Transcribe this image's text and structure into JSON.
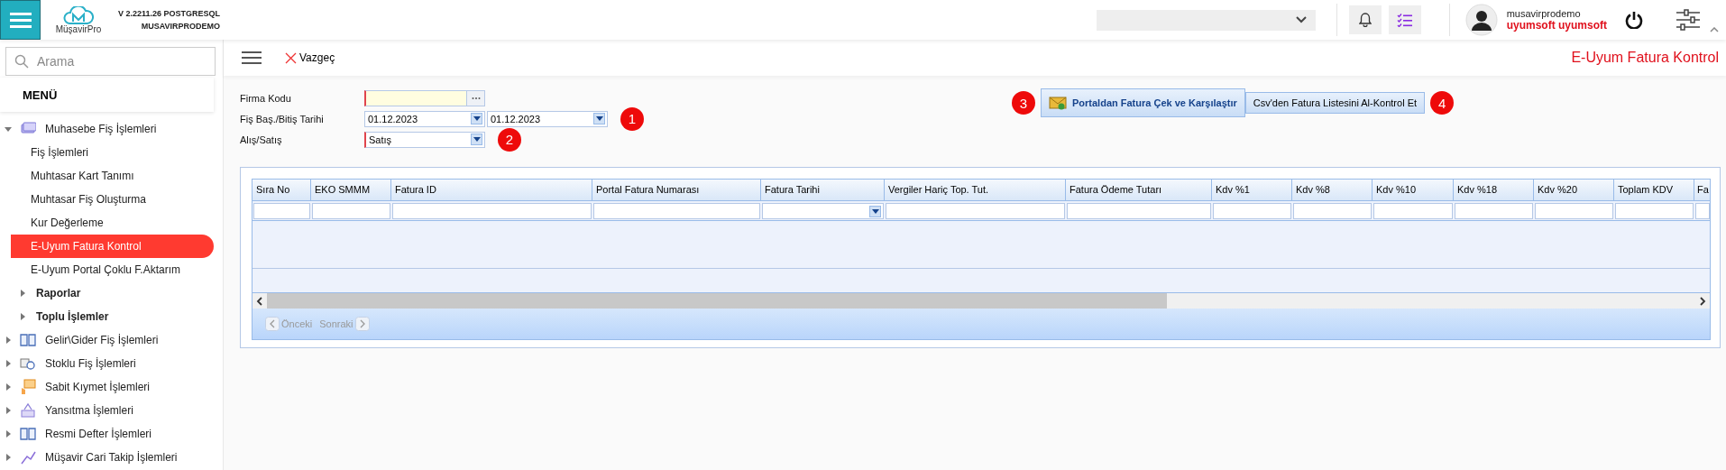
{
  "header": {
    "logo_text": "MüşavirPro",
    "version": "V 2.2211.26 POSTGRESQL",
    "database": "MUSAVIRPRODEMO",
    "user_name": "musavirprodemo",
    "user_company": "uyumsoft uyumsoft"
  },
  "sidebar": {
    "search_placeholder": "Arama",
    "menu_title": "MENÜ",
    "items": [
      {
        "label": "Muhasebe Fiş İşlemleri",
        "kind": "group",
        "expanded": true,
        "selected": false,
        "children": [
          {
            "label": "Fiş İşlemleri",
            "kind": "link",
            "selected": false
          },
          {
            "label": "Muhtasar Kart Tanımı",
            "kind": "link",
            "selected": false
          },
          {
            "label": "Muhtasar Fiş Oluşturma",
            "kind": "link",
            "selected": false
          },
          {
            "label": "Kur Değerleme",
            "kind": "link",
            "selected": false
          },
          {
            "label": "E-Uyum Fatura Kontrol",
            "kind": "link",
            "selected": true
          },
          {
            "label": "E-Uyum Portal Çoklu F.Aktarım",
            "kind": "link",
            "selected": false
          },
          {
            "label": "Raporlar",
            "kind": "group",
            "expanded": false,
            "selected": false
          },
          {
            "label": "Toplu İşlemler",
            "kind": "group",
            "expanded": false,
            "selected": false
          }
        ]
      },
      {
        "label": "Gelir\\Gider Fiş İşlemleri",
        "kind": "group",
        "expanded": false,
        "selected": false
      },
      {
        "label": "Stoklu Fiş İşlemleri",
        "kind": "group",
        "expanded": false,
        "selected": false
      },
      {
        "label": "Sabit Kıymet İşlemleri",
        "kind": "group",
        "expanded": false,
        "selected": false
      },
      {
        "label": "Yansıtma İşlemleri",
        "kind": "group",
        "expanded": false,
        "selected": false
      },
      {
        "label": "Resmi Defter İşlemleri",
        "kind": "group",
        "expanded": false,
        "selected": false
      },
      {
        "label": "Müşavir Cari Takip İşlemleri",
        "kind": "group",
        "expanded": false,
        "selected": false
      }
    ]
  },
  "toolbar": {
    "cancel_label": "Vazgeç",
    "page_title": "E-Uyum Fatura Kontrol"
  },
  "form": {
    "rows": [
      {
        "label": "Firma Kodu",
        "fields": [
          {
            "kind": "lookup",
            "required": true
          }
        ]
      },
      {
        "label": "Fiş Baş./Bitiş Tarihi",
        "fields": [
          {
            "kind": "combo",
            "value": "01.12.2023",
            "required": false
          },
          {
            "kind": "combo",
            "value": "01.12.2023",
            "required": false
          }
        ],
        "badge": "1"
      },
      {
        "label": "Alış/Satış",
        "fields": [
          {
            "kind": "combo",
            "value": "Satış",
            "required": true
          }
        ],
        "badge": "2"
      }
    ]
  },
  "actions": [
    {
      "kind": "badge",
      "text": "3"
    },
    {
      "kind": "button",
      "label": "Portaldan Fatura Çek ve Karşılaştır",
      "primary": true
    },
    {
      "kind": "button",
      "label": "Csv'den Fatura Listesini Al-Kontrol Et",
      "primary": false
    },
    {
      "kind": "badge",
      "text": "4"
    }
  ],
  "grid": {
    "columns": [
      {
        "label": "Sıra No",
        "filter_dropdown": false
      },
      {
        "label": "EKO SMMM",
        "filter_dropdown": false
      },
      {
        "label": "Fatura ID",
        "filter_dropdown": false
      },
      {
        "label": "Portal Fatura Numarası",
        "filter_dropdown": false
      },
      {
        "label": "Fatura Tarihi",
        "filter_dropdown": true
      },
      {
        "label": "Vergiler Hariç Top. Tut.",
        "filter_dropdown": false
      },
      {
        "label": "Fatura Ödeme Tutarı",
        "filter_dropdown": false
      },
      {
        "label": "Kdv %1",
        "filter_dropdown": false
      },
      {
        "label": "Kdv %8",
        "filter_dropdown": false
      },
      {
        "label": "Kdv %10",
        "filter_dropdown": false
      },
      {
        "label": "Kdv %18",
        "filter_dropdown": false
      },
      {
        "label": "Kdv %20",
        "filter_dropdown": false
      },
      {
        "label": "Toplam KDV",
        "filter_dropdown": false
      },
      {
        "label": "Fa",
        "filter_dropdown": false
      }
    ],
    "pager": {
      "previous": {
        "label": "Önceki",
        "disabled": true
      },
      "next": {
        "label": "Sonraki",
        "disabled": true
      }
    }
  }
}
